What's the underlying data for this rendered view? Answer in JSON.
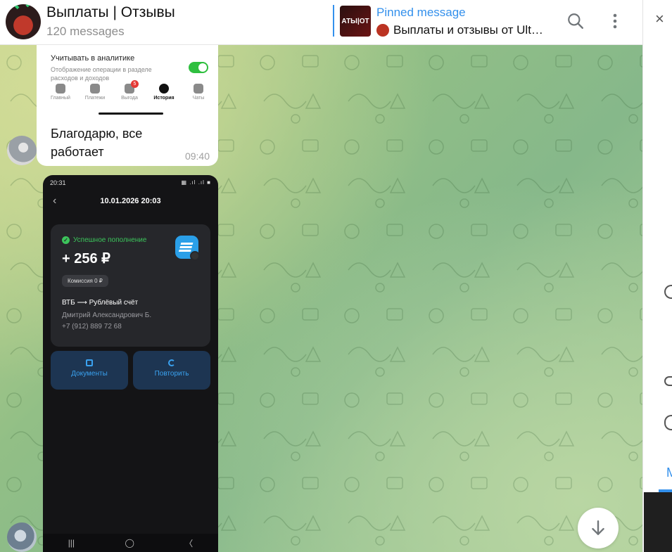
{
  "header": {
    "title": "Выплаты | Отзывы",
    "subtitle": "120 messages",
    "pinned_label": "Pinned message",
    "pinned_text": "Выплаты и отзывы от Ult…",
    "pinned_thumb_text": "АТЫ|ОТ"
  },
  "messages": [
    {
      "screenshot": {
        "setting_title": "Учитывать в аналитике",
        "setting_desc": "Отображение операции в разделе расходов и доходов",
        "nav": [
          "Главный",
          "Платежи",
          "Выгода",
          "История",
          "Чаты"
        ],
        "badge": "5"
      },
      "text": "Благодарю, все работает",
      "time": "09:40"
    },
    {
      "screenshot": {
        "status_time": "20:31",
        "status_icons": "▦ .ıl .ıl ■",
        "date": "10.01.2026 20:03",
        "status": "Успешное пополнение",
        "amount": "+ 256 ₽",
        "fee": "Комиссия 0 ₽",
        "route": "ВТБ ⟶ Рублёвый счёт",
        "name": "Дмитрий  Александрович Б.",
        "phone": "+7 (912) 889 72 68",
        "btn_docs": "Документы",
        "btn_repeat": "Повторить",
        "navbar": [
          "|||",
          "◯",
          "〈"
        ]
      }
    }
  ],
  "right_panel": {
    "close": "×",
    "letter": "M"
  },
  "colors": {
    "accent": "#3390ec",
    "success": "#3cc45b"
  }
}
